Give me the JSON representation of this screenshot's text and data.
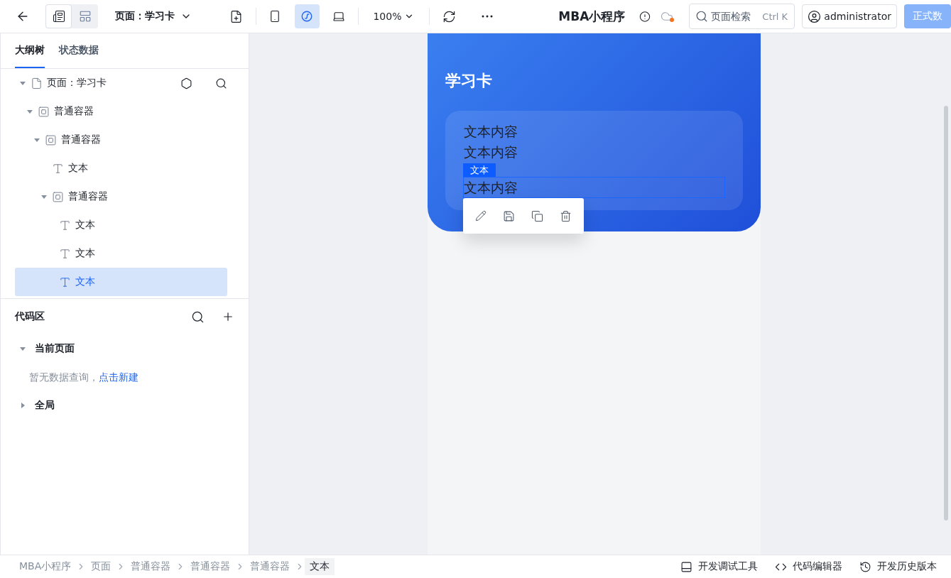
{
  "toolbar": {
    "views": [
      {
        "kind": "outline",
        "selected": true
      },
      {
        "kind": "layout",
        "selected": false
      }
    ],
    "page_selector": "页面：学习卡",
    "devices": [
      {
        "kind": "phone",
        "selected": false
      },
      {
        "kind": "miniprogram",
        "selected": true
      },
      {
        "kind": "laptop",
        "selected": false
      }
    ],
    "zoom": "100%",
    "title": "MBA小程序",
    "cloud_unsynced": true,
    "search": {
      "placeholder": "页面检索",
      "shortcut": "Ctrl K"
    },
    "user": "administrator",
    "publish_button": "正式数"
  },
  "left_tabs": [
    {
      "label": "大纲树",
      "selected": true
    },
    {
      "label": "状态数据",
      "selected": false
    }
  ],
  "tree": [
    {
      "kind": "page",
      "label": "页面：学习卡",
      "expanded": true,
      "selected": false,
      "children": [
        {
          "kind": "container",
          "label": "普通容器",
          "expanded": true,
          "selected": false,
          "children": [
            {
              "kind": "container",
              "label": "普通容器",
              "expanded": true,
              "selected": false,
              "children": [
                {
                  "kind": "text",
                  "label": "文本",
                  "selected": false
                },
                {
                  "kind": "container",
                  "label": "普通容器",
                  "expanded": true,
                  "selected": false,
                  "children": [
                    {
                      "kind": "text",
                      "label": "文本",
                      "selected": false
                    },
                    {
                      "kind": "text",
                      "label": "文本",
                      "selected": false
                    },
                    {
                      "kind": "text",
                      "label": "文本",
                      "selected": true
                    }
                  ]
                }
              ]
            }
          ]
        }
      ]
    }
  ],
  "code_area": {
    "title": "代码区",
    "groups": [
      {
        "label": "当前页面",
        "expanded": true,
        "empty_text": "暂无数据查询，",
        "empty_link": "点击新建"
      },
      {
        "label": "全局",
        "expanded": false
      }
    ]
  },
  "canvas": {
    "card_title": "学习卡",
    "lines": [
      {
        "text": "文本内容",
        "selected": false
      },
      {
        "text": "文本内容",
        "selected": false
      },
      {
        "text": "文本内容",
        "selected": true
      }
    ],
    "selection_tag": "文本"
  },
  "breadcrumb": [
    {
      "label": "MBA小程序",
      "selected": false
    },
    {
      "label": "页面",
      "selected": false
    },
    {
      "label": "普通容器",
      "selected": false
    },
    {
      "label": "普通容器",
      "selected": false
    },
    {
      "label": "普通容器",
      "selected": false
    },
    {
      "label": "文本",
      "selected": true
    }
  ],
  "footer_tools": [
    {
      "kind": "debug",
      "label": "开发调试工具"
    },
    {
      "kind": "code",
      "label": "代码编辑器"
    },
    {
      "kind": "history",
      "label": "开发历史版本"
    }
  ]
}
